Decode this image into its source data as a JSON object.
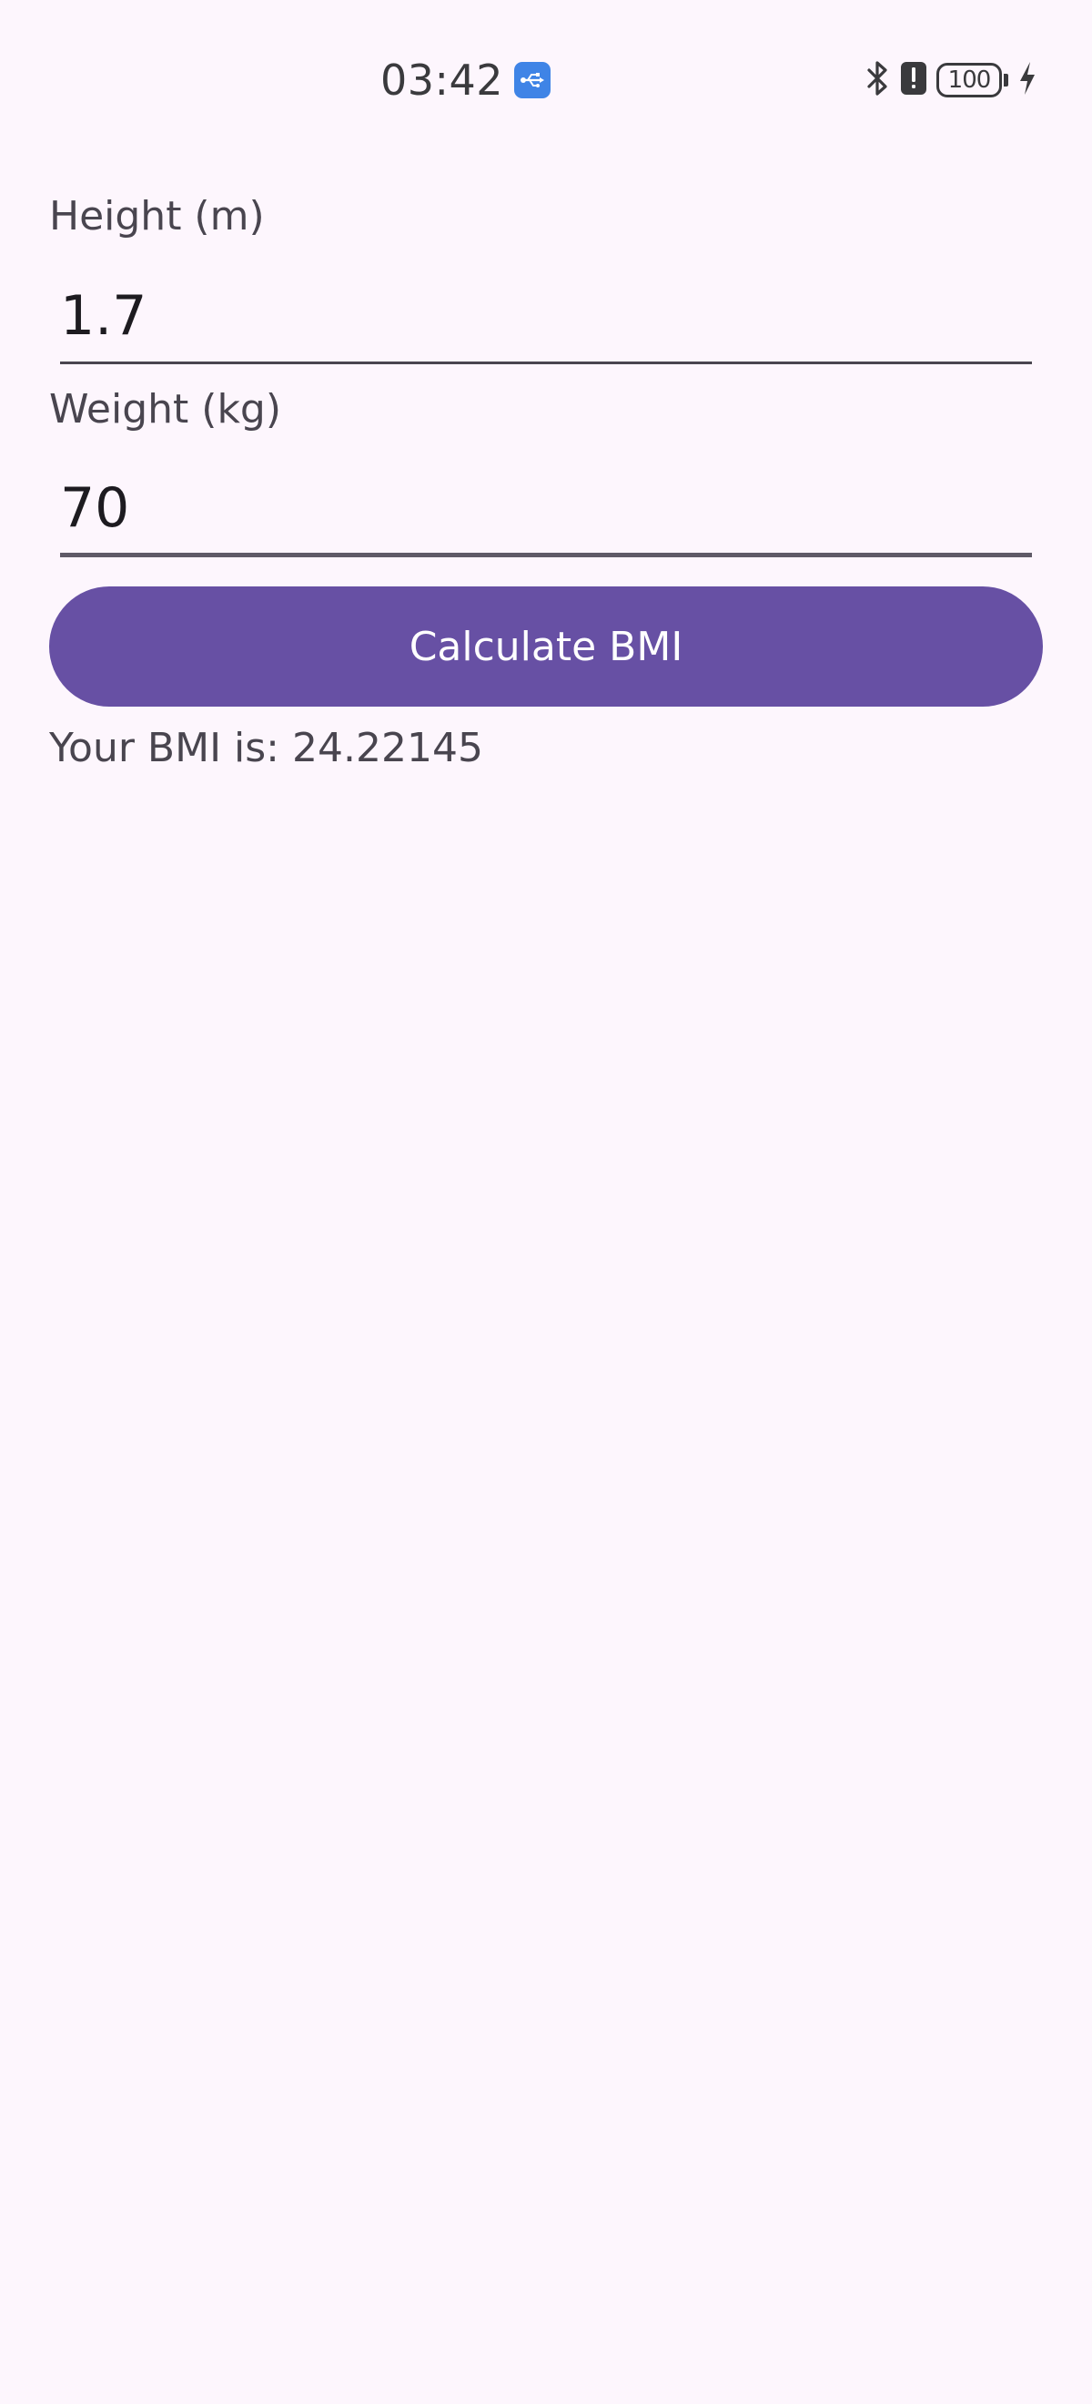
{
  "status_bar": {
    "time": "03:42",
    "battery_level": "100",
    "icons": [
      "usb-debugging-icon",
      "bluetooth-icon",
      "alert-icon",
      "battery-icon",
      "charging-icon"
    ]
  },
  "form": {
    "height": {
      "label": "Height (m)",
      "value": "1.7"
    },
    "weight": {
      "label": "Weight (kg)",
      "value": "70"
    },
    "calculate_label": "Calculate BMI"
  },
  "result": {
    "text": "Your BMI is: 24.22145"
  },
  "colors": {
    "background": "#fdf6fd",
    "accent": "#6750a4",
    "usb_badge": "#3f84e6"
  }
}
